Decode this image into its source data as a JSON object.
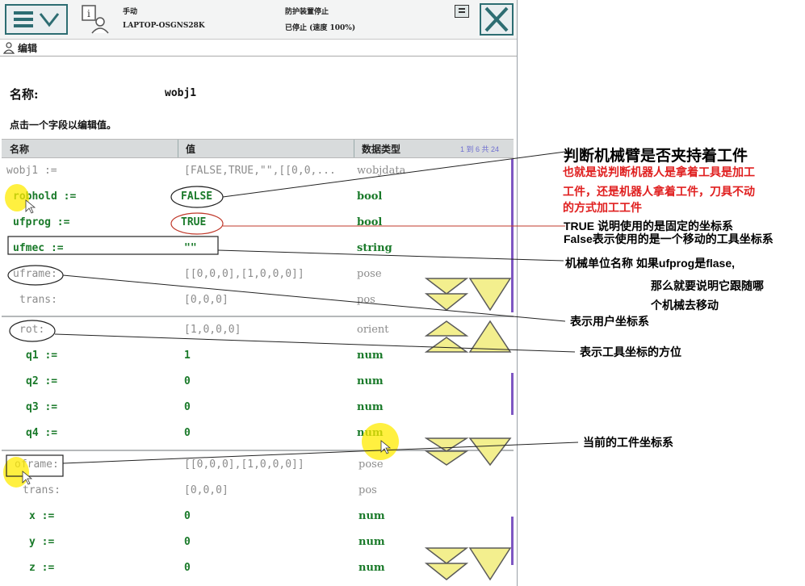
{
  "topbar": {
    "mode": "手动",
    "host": "LAPTOP-OSGNS28K",
    "guard": "防护装置停止",
    "state": "已停止 (速度 100%)"
  },
  "subheader": {
    "label": "编辑"
  },
  "form": {
    "name_label": "名称:",
    "name_value": "wobj1",
    "hint": "点击一个字段以编辑值。"
  },
  "table": {
    "headers": [
      "名称",
      "值",
      "数据类型"
    ],
    "pager": "1 到 6 共 24",
    "rows": [
      {
        "name": "wobj1 :=",
        "value": "[FALSE,TRUE,\"\",[[0,0,...",
        "type": "wobjdata"
      },
      {
        "name": "robhold :=",
        "value": "FALSE",
        "type": "bool"
      },
      {
        "name": "ufprog :=",
        "value": "TRUE",
        "type": "bool"
      },
      {
        "name": "ufmec :=",
        "value": "\"\"",
        "type": "string"
      },
      {
        "name": "uframe:",
        "value": "[[0,0,0],[1,0,0,0]]",
        "type": "pose"
      },
      {
        "name": "trans:",
        "value": "[0,0,0]",
        "type": "pos"
      },
      {
        "name": "rot:",
        "value": "[1,0,0,0]",
        "type": "orient"
      },
      {
        "name": "q1 :=",
        "value": "1",
        "type": "num"
      },
      {
        "name": "q2 :=",
        "value": "0",
        "type": "num"
      },
      {
        "name": "q3 :=",
        "value": "0",
        "type": "num"
      },
      {
        "name": "q4 :=",
        "value": "0",
        "type": "num"
      },
      {
        "name": "oframe:",
        "value": "[[0,0,0],[1,0,0,0]]",
        "type": "pose"
      },
      {
        "name": "trans:",
        "value": "[0,0,0]",
        "type": "pos"
      },
      {
        "name": "x :=",
        "value": "0",
        "type": "num"
      },
      {
        "name": "y :=",
        "value": "0",
        "type": "num"
      },
      {
        "name": "z :=",
        "value": "0",
        "type": "num"
      }
    ]
  },
  "annotations": {
    "robhold_title": "判断机械臂是否夹持着工件",
    "robhold_detail_1": "也就是说判断机器人是拿着工具是加工",
    "robhold_detail_2": "工件，还是机器人拿着工件，刀具不动",
    "robhold_detail_3": "的方式加工工件",
    "ufprog_true": "TRUE 说明使用的是固定的坐标系",
    "ufprog_false": "False表示使用的是一个移动的工具坐标系",
    "ufmec_1": "机械单位名称  如果ufprog是flase,",
    "ufmec_2": "那么就要说明它跟随哪",
    "ufmec_3": "个机械去移动",
    "uframe": "表示用户坐标系",
    "rot": "表示工具坐标的方位",
    "oframe": "当前的工件坐标系"
  },
  "colors": {
    "detail_red": "#e02020",
    "value_green": "#1a7a2a",
    "accent_teal": "#2d6d72"
  }
}
